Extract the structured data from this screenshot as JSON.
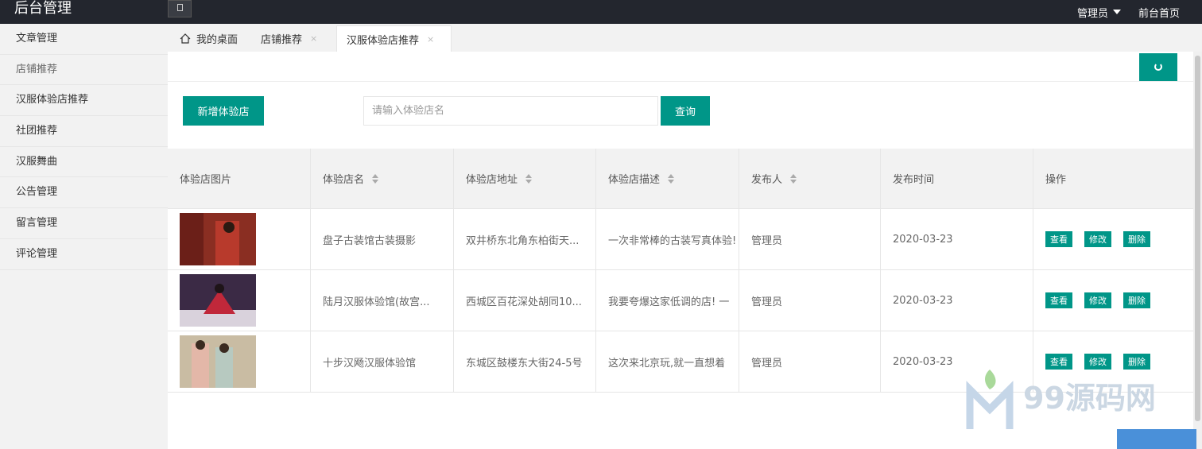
{
  "app": {
    "title": "后台管理"
  },
  "topbar": {
    "admin_label": "管理员",
    "front_link": "前台首页"
  },
  "sidebar": {
    "items": [
      {
        "label": "文章管理"
      },
      {
        "label": "店铺推荐"
      },
      {
        "label": "汉服体验店推荐"
      },
      {
        "label": "社团推荐"
      },
      {
        "label": "汉服舞曲"
      },
      {
        "label": "公告管理"
      },
      {
        "label": "留言管理"
      },
      {
        "label": "评论管理"
      }
    ]
  },
  "tabs": [
    {
      "label": "我的桌面",
      "icon": "home-icon"
    },
    {
      "label": "店铺推荐",
      "close": "×"
    },
    {
      "label": "汉服体验店推荐",
      "close": "×"
    }
  ],
  "toolbar": {
    "add_label": "新增体验店",
    "search_placeholder": "请输入体验店名",
    "search_label": "查询"
  },
  "table": {
    "headers": [
      "体验店图片",
      "体验店名",
      "体验店地址",
      "体验店描述",
      "发布人",
      "发布时间",
      "操作"
    ],
    "rows": [
      {
        "name": "盘子古装馆古装摄影",
        "address": "双井桥东北角东柏街天...",
        "desc": "一次非常棒的古装写真体验!",
        "publisher": "管理员",
        "date": "2020-03-23"
      },
      {
        "name": "陆月汉服体验馆(故宫...",
        "address": "西城区百花深处胡同10...",
        "desc": "我要夸爆这家低调的店! 一",
        "publisher": "管理员",
        "date": "2020-03-23"
      },
      {
        "name": "十步汉飏汉服体验馆",
        "address": "东城区鼓楼东大街24-5号",
        "desc": "这次来北京玩,就一直想着",
        "publisher": "管理员",
        "date": "2020-03-23"
      }
    ],
    "ops": {
      "view": "查看",
      "edit": "修改",
      "delete": "删除"
    }
  },
  "watermark": {
    "text": "99源码网"
  },
  "colors": {
    "primary": "#009688",
    "topbar": "#23262e"
  }
}
